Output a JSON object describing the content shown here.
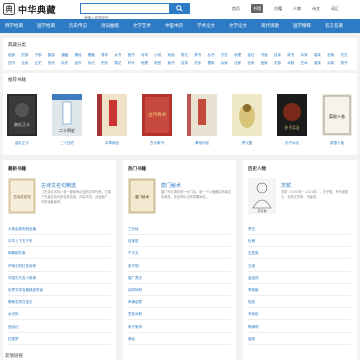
{
  "header": {
    "logo_mark": "典",
    "logo_text": "中华典藏",
    "search_placeholder": "请输入你想找的",
    "nav": [
      "首页",
      "书馆",
      "古籍",
      "人物",
      "诗文",
      "词汇"
    ]
  },
  "navbar": {
    "items": [
      "佛学经典",
      "国学经典",
      "历史传记",
      "诗词曲赋",
      "文学艺术",
      "中医中药",
      "学术论文",
      "文学论文",
      "现代诗歌",
      "国学精粹",
      "名言名著"
    ]
  },
  "categories_section": {
    "title": "典藏分类",
    "row1": [
      "经部",
      "史部",
      "子部",
      "集部",
      "道藏",
      "佛经",
      "儒藏",
      "易学",
      "兵书",
      "医书",
      "诗词",
      "小说",
      "戏曲",
      "笔记",
      "类书",
      "丛书",
      "方志",
      "地理",
      "金石",
      "书画",
      "目录",
      "政书",
      "杂家",
      "谱录",
      "农家",
      "天文"
    ],
    "row2": [
      "四书",
      "五经",
      "正史",
      "别史",
      "杂史",
      "诏令",
      "传记",
      "史钞",
      "载记",
      "时令",
      "地理",
      "职官",
      "政书",
      "目录",
      "史评",
      "儒家",
      "兵家",
      "法家",
      "农家",
      "医家",
      "天算",
      "术数",
      "艺术",
      "谱录",
      "杂家",
      "类书"
    ]
  },
  "recommend_section": {
    "title": "推荐书籍",
    "books": [
      {
        "title": "曲礼正义",
        "cover_text": "曲礼正义"
      },
      {
        "title": "二十四史",
        "cover_text": "二十四史"
      },
      {
        "title": "本草纲目",
        "cover_text": ""
      },
      {
        "title": "古代奇书",
        "cover_text": "古代奇书"
      },
      {
        "title": "黄帝内经",
        "cover_text": ""
      },
      {
        "title": "罗汉图",
        "cover_text": ""
      },
      {
        "title": "孙子兵法",
        "cover_text": "孙子兵法"
      },
      {
        "title": "菜根十香",
        "cover_text": "菜根十香"
      }
    ]
  },
  "col_left": {
    "title": "最新书籍",
    "feature_name": "古诗文名句精选",
    "feature_desc": "《古诗文名句》是一部极有价值的文学作品，汇集了先秦至清代的名家名篇，内容丰富，涉及面广，可供读者参考。",
    "cover_text": "古诗文名句",
    "list": [
      "大清会典则例全编",
      "中华上下五千年",
      "明朝那些事",
      "芦荡中的红色传奇",
      "中国古代名人轶事",
      "世界文学名著精选导读",
      "聊斋志异白话文",
      "水浒传",
      "西游记",
      "红楼梦"
    ]
  },
  "col_mid": {
    "title": "热门书籍",
    "feature_name": "唐门秘术",
    "feature_desc": "唐门为江湖中的一大门派，是一个以暗器毒药闻名的家族，在武林中占有重要地位。",
    "cover_text": "唐门秘术",
    "list": [
      "三字经",
      "百家姓",
      "千字文",
      "弟子规",
      "增广贤文",
      "幼学琼林",
      "声律启蒙",
      "笠翁对韵",
      "朱子家训",
      "孝经"
    ]
  },
  "col_right": {
    "title": "历史人物",
    "feature_name": "苏轼",
    "feature_desc": "苏轼（1037年－1101年），字子瞻，号东坡居士，北宋文学家、书画家。",
    "avatar_caption": "苏东坡",
    "list": [
      "李白",
      "杜甫",
      "白居易",
      "王维",
      "孟浩然",
      "李商隐",
      "陆游",
      "辛弃疾",
      "陶渊明",
      "屈原"
    ]
  },
  "footer_title": "友情链接"
}
